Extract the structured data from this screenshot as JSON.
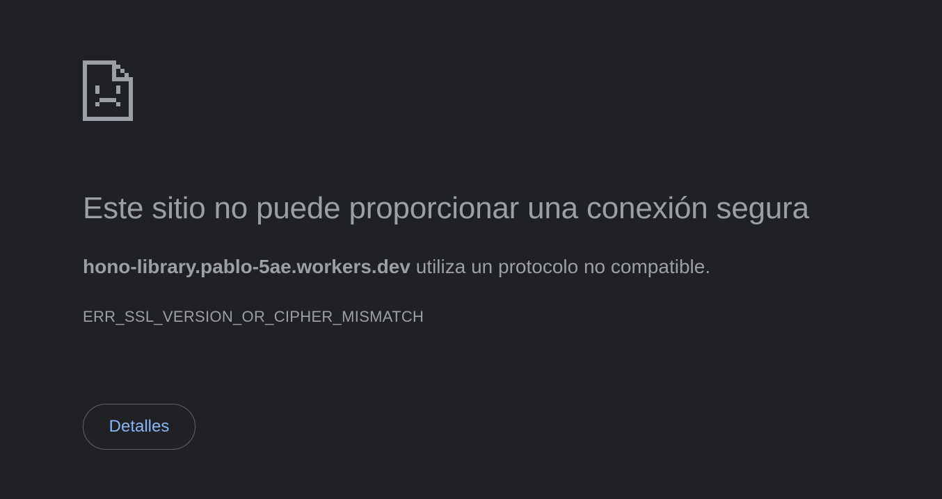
{
  "page": {
    "icon": "sad-page-icon",
    "title": "Este sitio no puede proporcionar una conexión segura",
    "message": {
      "host": "hono-library.pablo-5ae.workers.dev",
      "text": " utiliza un protocolo no compatible."
    },
    "error_code": "ERR_SSL_VERSION_OR_CIPHER_MISMATCH",
    "details_button_label": "Detalles"
  },
  "colors": {
    "background": "#202124",
    "text": "#9aa0a6",
    "link": "#8ab4f8",
    "button_border": "#5f6368"
  }
}
